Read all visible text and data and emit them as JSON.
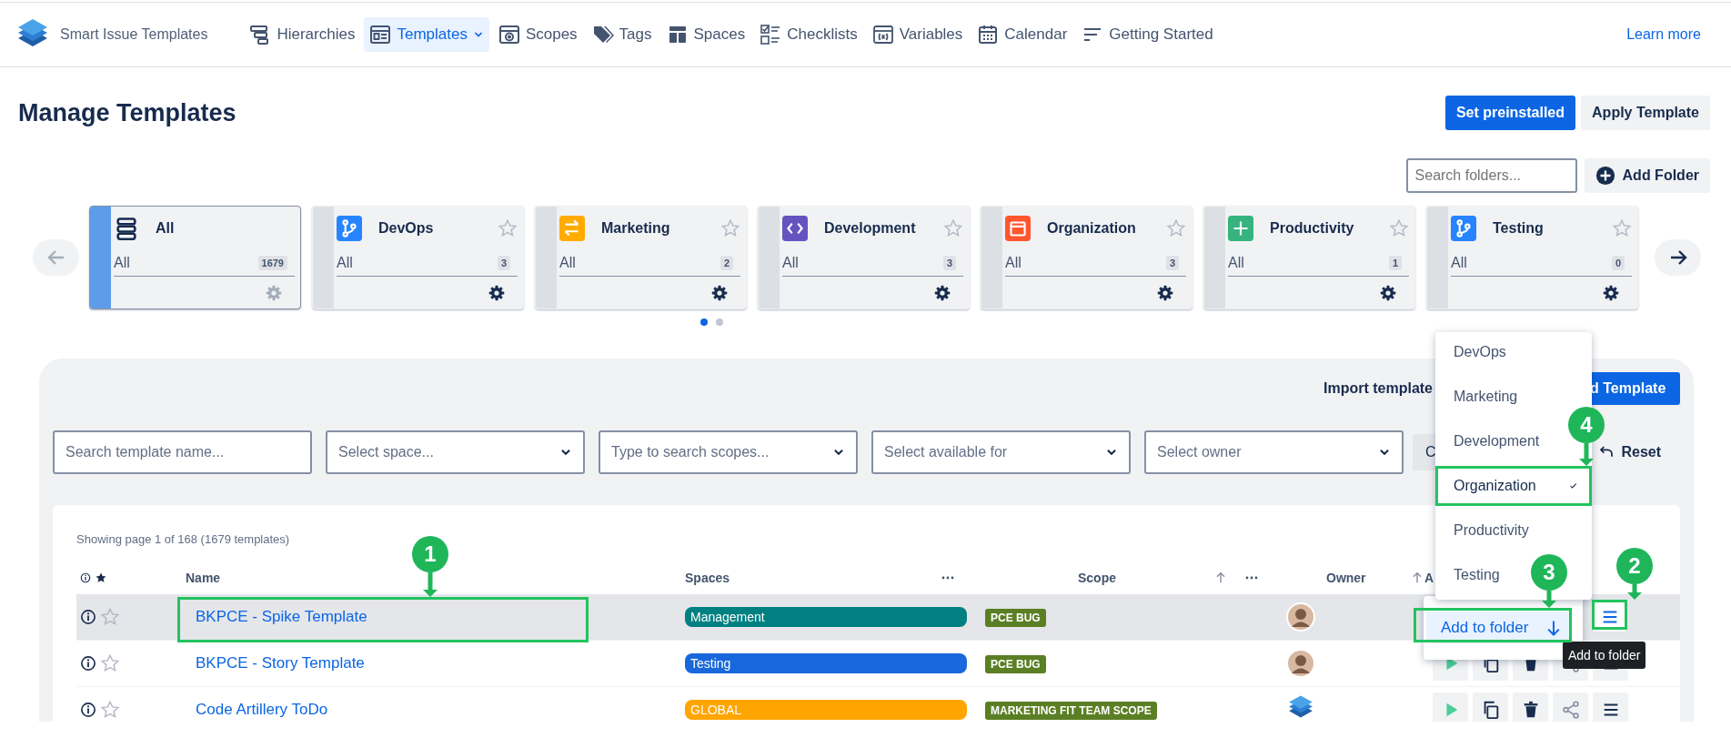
{
  "app": {
    "name": "Smart Issue Templates"
  },
  "nav": {
    "items": [
      {
        "label": "Hierarchies",
        "selected": false,
        "menu": false
      },
      {
        "label": "Templates",
        "selected": true,
        "menu": true
      },
      {
        "label": "Scopes",
        "selected": false,
        "menu": false
      },
      {
        "label": "Tags",
        "selected": false,
        "menu": false
      },
      {
        "label": "Spaces",
        "selected": false,
        "menu": false
      },
      {
        "label": "Checklists",
        "selected": false,
        "menu": false
      },
      {
        "label": "Variables",
        "selected": false,
        "menu": false
      },
      {
        "label": "Calendar",
        "selected": false,
        "menu": false
      },
      {
        "label": "Getting Started",
        "selected": false,
        "menu": false
      }
    ],
    "link": "Learn more"
  },
  "page": {
    "title": "Manage Templates",
    "buttons": [
      {
        "label": "Set preinstalled",
        "kind": "primary"
      },
      {
        "label": "Apply Template",
        "kind": "default"
      }
    ]
  },
  "folder_search": {
    "placeholder": "Search folders...",
    "add_button": "Add Folder"
  },
  "carousel": {
    "prev_enabled": false,
    "next_enabled": true,
    "pages": [
      {
        "selected": true
      },
      {
        "selected": false
      }
    ]
  },
  "folders": [
    {
      "kind": "all",
      "name": "All",
      "subtitle": "All",
      "count": "1679",
      "selected": true
    },
    {
      "kind": "folder",
      "name": "DevOps",
      "color": "#2684ff",
      "subtitle": "All",
      "count": "3",
      "selected": false,
      "starred": false
    },
    {
      "kind": "folder",
      "name": "Marketing",
      "color": "#ffab00",
      "subtitle": "All",
      "count": "2",
      "selected": false,
      "starred": false
    },
    {
      "kind": "folder",
      "name": "Development",
      "color": "#6554c0",
      "subtitle": "All",
      "count": "3",
      "selected": false,
      "starred": false
    },
    {
      "kind": "folder",
      "name": "Organization",
      "color": "#ff5630",
      "subtitle": "All",
      "count": "3",
      "selected": false,
      "starred": false
    },
    {
      "kind": "folder",
      "name": "Productivity",
      "color": "#36b37e",
      "subtitle": "All",
      "count": "1",
      "selected": false,
      "starred": false
    },
    {
      "kind": "folder",
      "name": "Testing",
      "color": "#2684ff",
      "subtitle": "All",
      "count": "0",
      "selected": false,
      "starred": false
    }
  ],
  "templates_panel": {
    "import_label": "Import template",
    "add_button": "d Template",
    "filters": [
      {
        "kind": "text",
        "placeholder": "Search template name..."
      },
      {
        "kind": "select",
        "placeholder": "Select space..."
      },
      {
        "kind": "select",
        "placeholder": "Type to search scopes..."
      },
      {
        "kind": "select",
        "placeholder": "Select available for"
      },
      {
        "kind": "select",
        "placeholder": "Select owner"
      }
    ],
    "clear_button": "C",
    "reset_button": "Reset"
  },
  "table": {
    "summary": "Showing page 1 of 168 (1679 templates)",
    "columns": [
      {
        "label": "Name",
        "sortable": false,
        "menu": false
      },
      {
        "label": "Spaces",
        "sortable": false,
        "menu": true
      },
      {
        "label": "Scope",
        "sortable": true,
        "menu": true
      },
      {
        "label": "Owner",
        "sortable": true,
        "menu": false
      },
      {
        "label": "A",
        "sortable": false,
        "menu": false
      }
    ],
    "rows": [
      {
        "name": "BKPCE - Spike Template",
        "selected": true,
        "starred": false,
        "space": {
          "label": "Management",
          "color": "#008080"
        },
        "scope": "PCE BUG",
        "owner": {
          "kind": "person"
        },
        "menu_open": true
      },
      {
        "name": "BKPCE - Story Template",
        "selected": false,
        "starred": false,
        "space": {
          "label": "Testing",
          "color": "#1868db"
        },
        "scope": "PCE BUG",
        "owner": {
          "kind": "person"
        },
        "menu_open": false
      },
      {
        "name": "Code Artillery ToDo",
        "selected": false,
        "starred": false,
        "space": {
          "label": "GLOBAL",
          "color": "#ffa500"
        },
        "scope": "MARKETING FIT TEAM SCOPE",
        "owner": {
          "kind": "logo"
        },
        "menu_open": false
      }
    ]
  },
  "folder_menu": {
    "items": [
      {
        "label": "DevOps",
        "selected": false,
        "highlighted": false
      },
      {
        "label": "Marketing",
        "selected": false,
        "highlighted": false
      },
      {
        "label": "Development",
        "selected": false,
        "highlighted": false
      },
      {
        "label": "Organization",
        "selected": true,
        "highlighted": true
      },
      {
        "label": "Productivity",
        "selected": false,
        "highlighted": false
      },
      {
        "label": "Testing",
        "selected": false,
        "highlighted": false
      }
    ],
    "add_button": "Add to folder",
    "tooltip": "Add to folder"
  },
  "annotations": [
    {
      "number": "1"
    },
    {
      "number": "2"
    },
    {
      "number": "3"
    },
    {
      "number": "4"
    }
  ]
}
